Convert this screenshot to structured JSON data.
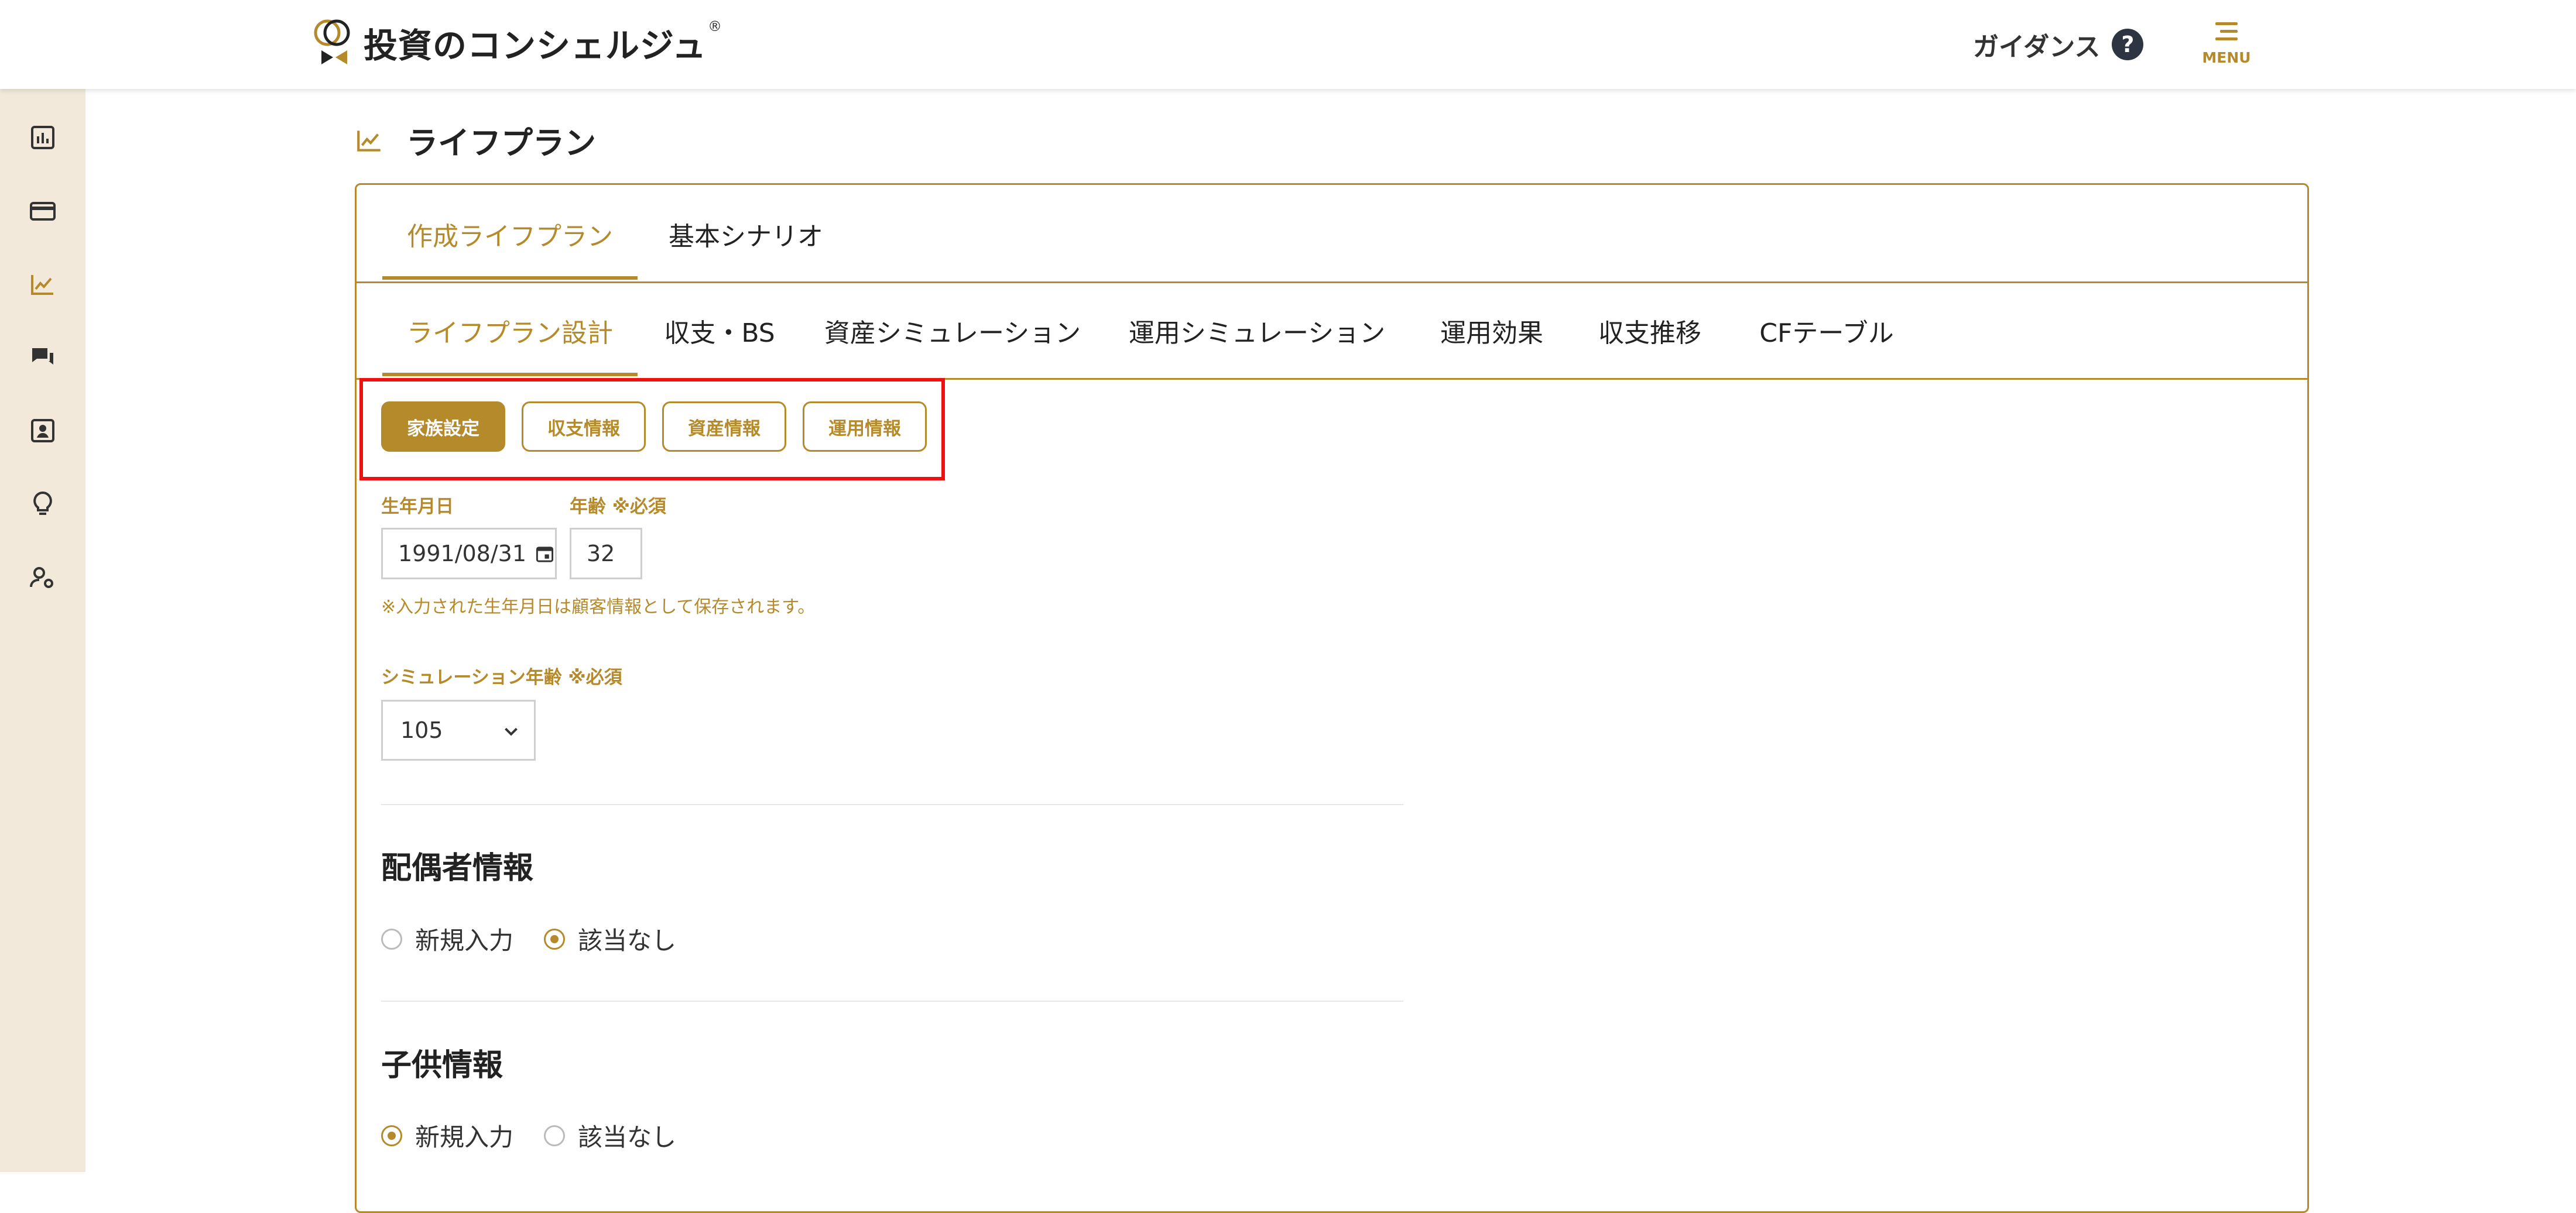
{
  "header": {
    "app_name": "投資のコンシェルジュ",
    "registered_mark": "®",
    "guidance_label": "ガイダンス",
    "help_glyph": "?",
    "menu_label": "MENU"
  },
  "sidebar": {
    "items": [
      {
        "icon": "dashboard-chart-icon"
      },
      {
        "icon": "credit-card-icon"
      },
      {
        "icon": "trend-chart-icon",
        "active": true
      },
      {
        "icon": "chat-icon"
      },
      {
        "icon": "contact-card-icon"
      },
      {
        "icon": "lightbulb-icon"
      },
      {
        "icon": "user-settings-icon"
      }
    ]
  },
  "page": {
    "title": "ライフプラン",
    "title_icon": "trend-chart-icon"
  },
  "tabs_primary": [
    {
      "label": "作成ライフプラン",
      "active": true
    },
    {
      "label": "基本シナリオ",
      "active": false
    }
  ],
  "tabs_secondary": [
    {
      "label": "ライフプラン設計",
      "active": true
    },
    {
      "label": "収支・BS",
      "active": false
    },
    {
      "label": "資産シミュレーション",
      "active": false
    },
    {
      "label": "運用シミュレーション",
      "active": false
    },
    {
      "label": "運用効果",
      "active": false
    },
    {
      "label": "収支推移",
      "active": false
    },
    {
      "label": "CFテーブル",
      "active": false
    }
  ],
  "segment_buttons": [
    {
      "label": "家族設定",
      "active": true
    },
    {
      "label": "収支情報",
      "active": false
    },
    {
      "label": "資産情報",
      "active": false
    },
    {
      "label": "運用情報",
      "active": false
    }
  ],
  "form": {
    "birthdate_label": "生年月日",
    "birthdate_value": "1991/08/31",
    "age_label": "年齢 ※必須",
    "age_value": "32",
    "birthdate_note": "※入力された生年月日は顧客情報として保存されます。",
    "sim_age_label": "シミュレーション年齢 ※必須",
    "sim_age_value": "105"
  },
  "spouse": {
    "title": "配偶者情報",
    "options": [
      {
        "label": "新規入力",
        "checked": false
      },
      {
        "label": "該当なし",
        "checked": true
      }
    ]
  },
  "children": {
    "title": "子供情報",
    "options": [
      {
        "label": "新規入力",
        "checked": true
      },
      {
        "label": "該当なし",
        "checked": false
      }
    ]
  },
  "colors": {
    "accent": "#b58a2b",
    "sidebar_bg": "#f2e9db",
    "highlight": "#e11111"
  }
}
